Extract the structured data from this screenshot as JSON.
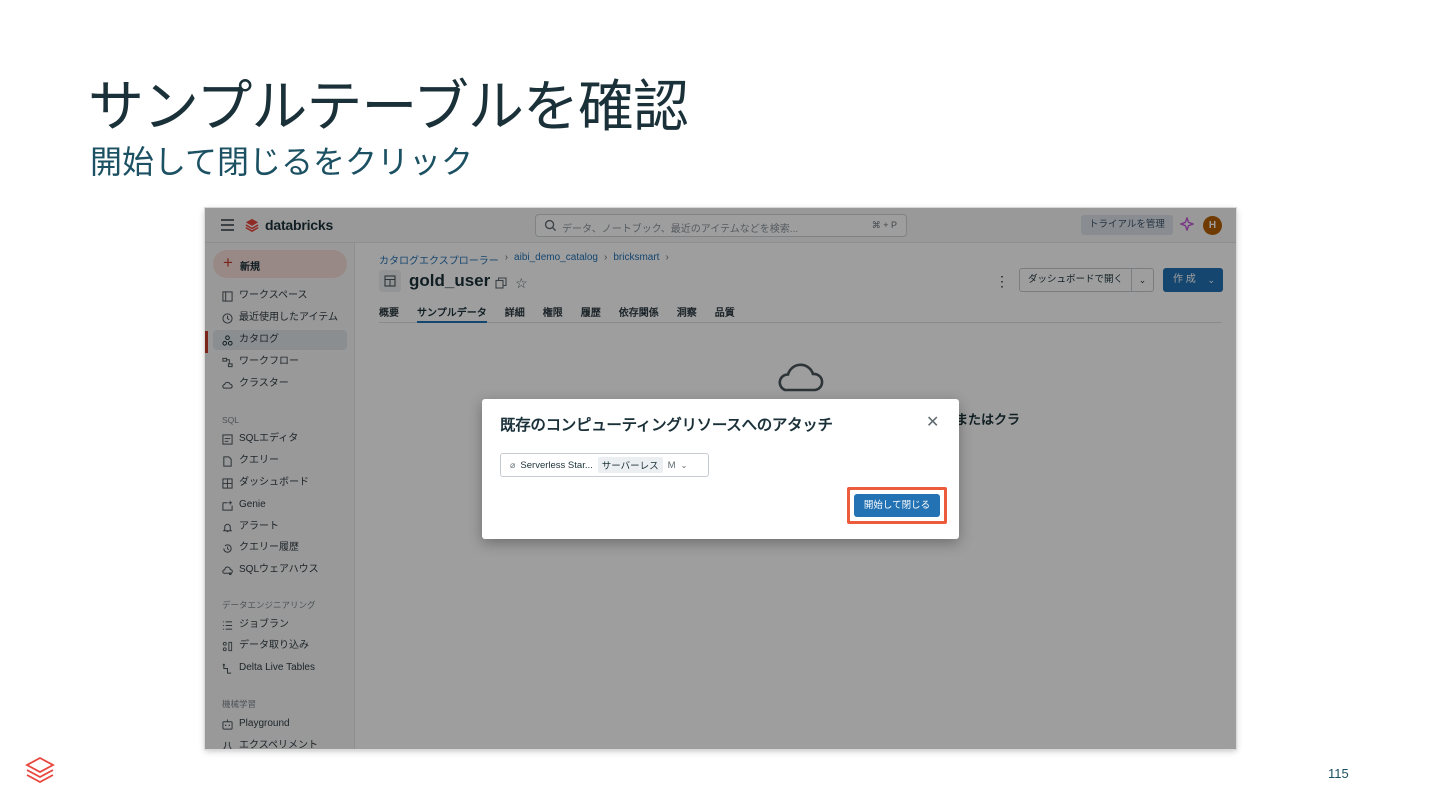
{
  "slide": {
    "title": "サンプルテーブルを確認",
    "subtitle": "開始して閉じるをクリック",
    "page_number": "115"
  },
  "app": {
    "brand_name": "databricks",
    "search_placeholder": "データ、ノートブック、最近のアイテムなどを検索...",
    "search_shortcut": "⌘ + P",
    "trial_label": "トライアルを管理",
    "avatar_initial": "H",
    "brand_color": "#c63b2b",
    "accent_color": "#2272b4"
  },
  "sidebar": {
    "new_label": "新規",
    "items": [
      {
        "label": "ワークスペース",
        "icon": "workspace-icon"
      },
      {
        "label": "最近使用したアイテム",
        "icon": "clock-icon"
      },
      {
        "label": "カタログ",
        "icon": "catalog-icon"
      },
      {
        "label": "ワークフロー",
        "icon": "workflow-icon"
      },
      {
        "label": "クラスター",
        "icon": "cloud-icon"
      }
    ],
    "sql_section": "SQL",
    "sql_items": [
      {
        "label": "SQLエディタ",
        "icon": "sql-editor-icon"
      },
      {
        "label": "クエリー",
        "icon": "query-icon"
      },
      {
        "label": "ダッシュボード",
        "icon": "dashboard-icon"
      },
      {
        "label": "Genie",
        "icon": "genie-icon"
      },
      {
        "label": "アラート",
        "icon": "bell-icon"
      },
      {
        "label": "クエリー履歴",
        "icon": "history-icon"
      },
      {
        "label": "SQLウェアハウス",
        "icon": "warehouse-icon"
      }
    ],
    "de_section": "データエンジニアリング",
    "de_items": [
      {
        "label": "ジョブラン",
        "icon": "job-runs-icon"
      },
      {
        "label": "データ取り込み",
        "icon": "ingest-icon"
      },
      {
        "label": "Delta Live Tables",
        "icon": "dlt-icon"
      }
    ],
    "ml_section": "機械学習",
    "ml_items": [
      {
        "label": "Playground",
        "icon": "playground-icon"
      },
      {
        "label": "エクスペリメント",
        "icon": "experiment-icon"
      }
    ]
  },
  "main": {
    "breadcrumb": [
      "カタログエクスプローラー",
      "aibi_demo_catalog",
      "bricksmart"
    ],
    "heading": "gold_user",
    "open_dashboard_label": "ダッシュボードで開く",
    "create_label": "作 成",
    "tabs": [
      "概要",
      "サンプルデータ",
      "詳細",
      "権限",
      "履歴",
      "依存関係",
      "洞察",
      "品質"
    ],
    "active_tab": "サンプルデータ",
    "empty_text_partial": "またはクラ"
  },
  "modal": {
    "title": "既存のコンピューティングリソースへのアタッチ",
    "compute_name": "Serverless Star...",
    "compute_type": "サーバーレス",
    "compute_size": "M",
    "start_button": "開始して閉じる",
    "highlight_color": "#eb5b3c"
  }
}
